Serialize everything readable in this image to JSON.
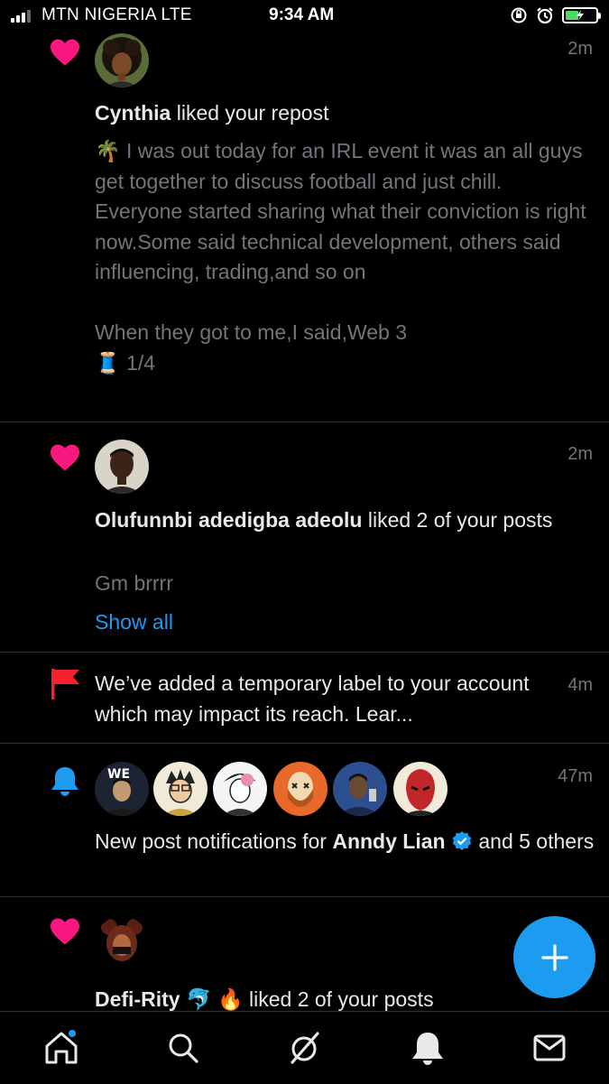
{
  "status_bar": {
    "carrier": "MTN NIGERIA   LTE",
    "time": "9:34 AM"
  },
  "notifications": [
    {
      "kind": "like",
      "time": "2m",
      "user": "Cynthia",
      "action": " liked your repost",
      "body_emoji": "🌴",
      "body": " I was out today for an IRL event it was an all guys get together to discuss football and just chill. Everyone started sharing what their conviction is right now.Some said technical development, others said influencing, trading,and so on\n\nWhen they got to me,I said,Web 3",
      "thread_emoji": "🧵",
      "thread": " 1/4"
    },
    {
      "kind": "like",
      "time": "2m",
      "user": "Olufunnbi adedigba adeolu",
      "action": " liked 2 of your posts",
      "body": "Gm brrrr",
      "show_all": "Show all"
    },
    {
      "kind": "flag",
      "time": "4m",
      "text": "We’ve added a temporary label to your account which may impact its reach. Lear..."
    },
    {
      "kind": "bell",
      "time": "47m",
      "prefix": "New post notifications for ",
      "user": "Anndy Lian",
      "suffix": " and 5 others"
    },
    {
      "kind": "like",
      "time": "",
      "user": "Defi-Rity",
      "user_emoji": " 🐬 🔥",
      "action": " liked 2 of your posts"
    }
  ],
  "colors": {
    "accent": "#1d9bf0",
    "like": "#f91880",
    "flag": "#f4212e",
    "muted": "#71767b"
  }
}
